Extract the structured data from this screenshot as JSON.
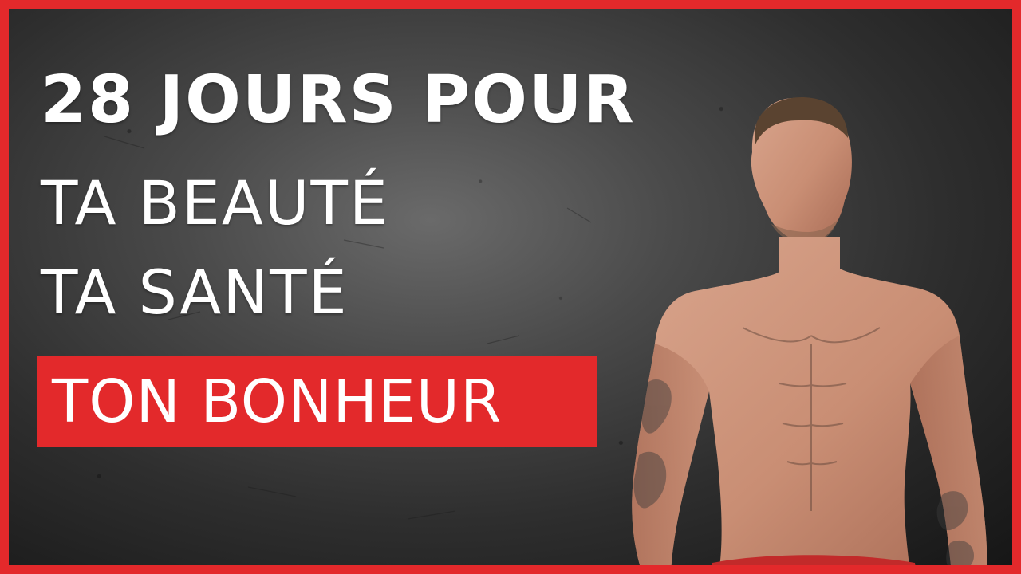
{
  "headline": {
    "line1": "28 JOURS POUR",
    "line2": "TA BEAUTÉ",
    "line3": "TA SANTÉ",
    "highlight": "TON BONHEUR"
  },
  "colors": {
    "accent": "#e3292b",
    "text": "#ffffff",
    "background": "#2e2e2e"
  },
  "image": {
    "subject_icon": "shirtless-man-photo"
  }
}
